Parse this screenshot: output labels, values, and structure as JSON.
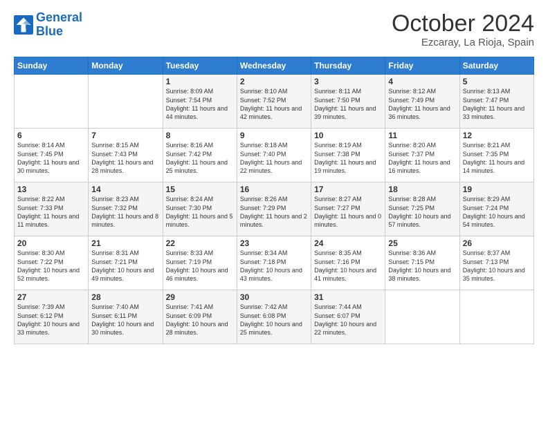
{
  "logo": {
    "line1": "General",
    "line2": "Blue"
  },
  "title": "October 2024",
  "location": "Ezcaray, La Rioja, Spain",
  "weekdays": [
    "Sunday",
    "Monday",
    "Tuesday",
    "Wednesday",
    "Thursday",
    "Friday",
    "Saturday"
  ],
  "weeks": [
    [
      {
        "day": "",
        "sunrise": "",
        "sunset": "",
        "daylight": ""
      },
      {
        "day": "",
        "sunrise": "",
        "sunset": "",
        "daylight": ""
      },
      {
        "day": "1",
        "sunrise": "Sunrise: 8:09 AM",
        "sunset": "Sunset: 7:54 PM",
        "daylight": "Daylight: 11 hours and 44 minutes."
      },
      {
        "day": "2",
        "sunrise": "Sunrise: 8:10 AM",
        "sunset": "Sunset: 7:52 PM",
        "daylight": "Daylight: 11 hours and 42 minutes."
      },
      {
        "day": "3",
        "sunrise": "Sunrise: 8:11 AM",
        "sunset": "Sunset: 7:50 PM",
        "daylight": "Daylight: 11 hours and 39 minutes."
      },
      {
        "day": "4",
        "sunrise": "Sunrise: 8:12 AM",
        "sunset": "Sunset: 7:49 PM",
        "daylight": "Daylight: 11 hours and 36 minutes."
      },
      {
        "day": "5",
        "sunrise": "Sunrise: 8:13 AM",
        "sunset": "Sunset: 7:47 PM",
        "daylight": "Daylight: 11 hours and 33 minutes."
      }
    ],
    [
      {
        "day": "6",
        "sunrise": "Sunrise: 8:14 AM",
        "sunset": "Sunset: 7:45 PM",
        "daylight": "Daylight: 11 hours and 30 minutes."
      },
      {
        "day": "7",
        "sunrise": "Sunrise: 8:15 AM",
        "sunset": "Sunset: 7:43 PM",
        "daylight": "Daylight: 11 hours and 28 minutes."
      },
      {
        "day": "8",
        "sunrise": "Sunrise: 8:16 AM",
        "sunset": "Sunset: 7:42 PM",
        "daylight": "Daylight: 11 hours and 25 minutes."
      },
      {
        "day": "9",
        "sunrise": "Sunrise: 8:18 AM",
        "sunset": "Sunset: 7:40 PM",
        "daylight": "Daylight: 11 hours and 22 minutes."
      },
      {
        "day": "10",
        "sunrise": "Sunrise: 8:19 AM",
        "sunset": "Sunset: 7:38 PM",
        "daylight": "Daylight: 11 hours and 19 minutes."
      },
      {
        "day": "11",
        "sunrise": "Sunrise: 8:20 AM",
        "sunset": "Sunset: 7:37 PM",
        "daylight": "Daylight: 11 hours and 16 minutes."
      },
      {
        "day": "12",
        "sunrise": "Sunrise: 8:21 AM",
        "sunset": "Sunset: 7:35 PM",
        "daylight": "Daylight: 11 hours and 14 minutes."
      }
    ],
    [
      {
        "day": "13",
        "sunrise": "Sunrise: 8:22 AM",
        "sunset": "Sunset: 7:33 PM",
        "daylight": "Daylight: 11 hours and 11 minutes."
      },
      {
        "day": "14",
        "sunrise": "Sunrise: 8:23 AM",
        "sunset": "Sunset: 7:32 PM",
        "daylight": "Daylight: 11 hours and 8 minutes."
      },
      {
        "day": "15",
        "sunrise": "Sunrise: 8:24 AM",
        "sunset": "Sunset: 7:30 PM",
        "daylight": "Daylight: 11 hours and 5 minutes."
      },
      {
        "day": "16",
        "sunrise": "Sunrise: 8:26 AM",
        "sunset": "Sunset: 7:29 PM",
        "daylight": "Daylight: 11 hours and 2 minutes."
      },
      {
        "day": "17",
        "sunrise": "Sunrise: 8:27 AM",
        "sunset": "Sunset: 7:27 PM",
        "daylight": "Daylight: 11 hours and 0 minutes."
      },
      {
        "day": "18",
        "sunrise": "Sunrise: 8:28 AM",
        "sunset": "Sunset: 7:25 PM",
        "daylight": "Daylight: 10 hours and 57 minutes."
      },
      {
        "day": "19",
        "sunrise": "Sunrise: 8:29 AM",
        "sunset": "Sunset: 7:24 PM",
        "daylight": "Daylight: 10 hours and 54 minutes."
      }
    ],
    [
      {
        "day": "20",
        "sunrise": "Sunrise: 8:30 AM",
        "sunset": "Sunset: 7:22 PM",
        "daylight": "Daylight: 10 hours and 52 minutes."
      },
      {
        "day": "21",
        "sunrise": "Sunrise: 8:31 AM",
        "sunset": "Sunset: 7:21 PM",
        "daylight": "Daylight: 10 hours and 49 minutes."
      },
      {
        "day": "22",
        "sunrise": "Sunrise: 8:33 AM",
        "sunset": "Sunset: 7:19 PM",
        "daylight": "Daylight: 10 hours and 46 minutes."
      },
      {
        "day": "23",
        "sunrise": "Sunrise: 8:34 AM",
        "sunset": "Sunset: 7:18 PM",
        "daylight": "Daylight: 10 hours and 43 minutes."
      },
      {
        "day": "24",
        "sunrise": "Sunrise: 8:35 AM",
        "sunset": "Sunset: 7:16 PM",
        "daylight": "Daylight: 10 hours and 41 minutes."
      },
      {
        "day": "25",
        "sunrise": "Sunrise: 8:36 AM",
        "sunset": "Sunset: 7:15 PM",
        "daylight": "Daylight: 10 hours and 38 minutes."
      },
      {
        "day": "26",
        "sunrise": "Sunrise: 8:37 AM",
        "sunset": "Sunset: 7:13 PM",
        "daylight": "Daylight: 10 hours and 35 minutes."
      }
    ],
    [
      {
        "day": "27",
        "sunrise": "Sunrise: 7:39 AM",
        "sunset": "Sunset: 6:12 PM",
        "daylight": "Daylight: 10 hours and 33 minutes."
      },
      {
        "day": "28",
        "sunrise": "Sunrise: 7:40 AM",
        "sunset": "Sunset: 6:11 PM",
        "daylight": "Daylight: 10 hours and 30 minutes."
      },
      {
        "day": "29",
        "sunrise": "Sunrise: 7:41 AM",
        "sunset": "Sunset: 6:09 PM",
        "daylight": "Daylight: 10 hours and 28 minutes."
      },
      {
        "day": "30",
        "sunrise": "Sunrise: 7:42 AM",
        "sunset": "Sunset: 6:08 PM",
        "daylight": "Daylight: 10 hours and 25 minutes."
      },
      {
        "day": "31",
        "sunrise": "Sunrise: 7:44 AM",
        "sunset": "Sunset: 6:07 PM",
        "daylight": "Daylight: 10 hours and 22 minutes."
      },
      {
        "day": "",
        "sunrise": "",
        "sunset": "",
        "daylight": ""
      },
      {
        "day": "",
        "sunrise": "",
        "sunset": "",
        "daylight": ""
      }
    ]
  ]
}
